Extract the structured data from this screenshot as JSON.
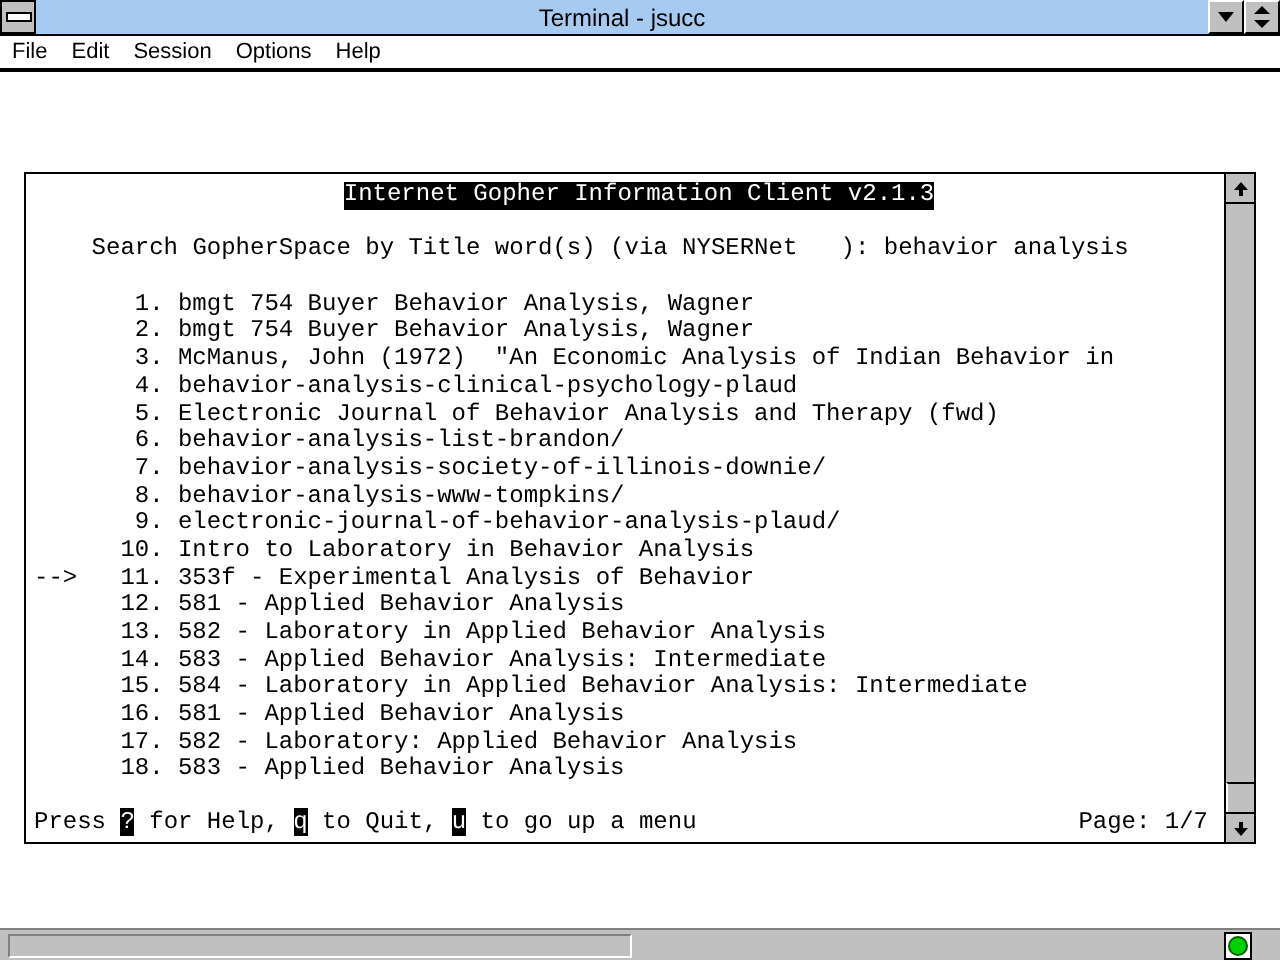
{
  "window": {
    "title": "Terminal - jsucc"
  },
  "menu": [
    "File",
    "Edit",
    "Session",
    "Options",
    "Help"
  ],
  "gopher": {
    "header": "Internet Gopher Information Client v2.1.3",
    "prompt": "Search GopherSpace by Title word(s) (via NYSERNet   ): behavior analysis",
    "items": [
      {
        "number": "1.",
        "title": "bmgt 754 Buyer Behavior Analysis, Wagner"
      },
      {
        "number": "2.",
        "title": "bmgt 754 Buyer Behavior Analysis, Wagner"
      },
      {
        "number": "3.",
        "title": "McManus, John (1972)  \"An Economic Analysis of Indian Behavior in"
      },
      {
        "number": "4.",
        "title": "behavior-analysis-clinical-psychology-plaud"
      },
      {
        "number": "5.",
        "title": "Electronic Journal of Behavior Analysis and Therapy (fwd)"
      },
      {
        "number": "6.",
        "title": "behavior-analysis-list-brandon/"
      },
      {
        "number": "7.",
        "title": "behavior-analysis-society-of-illinois-downie/"
      },
      {
        "number": "8.",
        "title": "behavior-analysis-www-tompkins/"
      },
      {
        "number": "9.",
        "title": "electronic-journal-of-behavior-analysis-plaud/"
      },
      {
        "number": "10.",
        "title": "Intro to Laboratory in Behavior Analysis"
      },
      {
        "pointer": "-->",
        "number": "11.",
        "title": "353f - Experimental Analysis of Behavior"
      },
      {
        "number": "12.",
        "title": "581 - Applied Behavior Analysis"
      },
      {
        "number": "13.",
        "title": "582 - Laboratory in Applied Behavior Analysis"
      },
      {
        "number": "14.",
        "title": "583 - Applied Behavior Analysis: Intermediate"
      },
      {
        "number": "15.",
        "title": "584 - Laboratory in Applied Behavior Analysis: Intermediate"
      },
      {
        "number": "16.",
        "title": "581 - Applied Behavior Analysis"
      },
      {
        "number": "17.",
        "title": "582 - Laboratory: Applied Behavior Analysis"
      },
      {
        "number": "18.",
        "title": "583 - Applied Behavior Analysis"
      }
    ],
    "footer": [
      {
        "text": "Press ",
        "inverse": false
      },
      {
        "text": "?",
        "inverse": true
      },
      {
        "text": " for Help, ",
        "inverse": false
      },
      {
        "text": "q",
        "inverse": true
      },
      {
        "text": " to Quit, ",
        "inverse": false
      },
      {
        "text": "u",
        "inverse": true
      },
      {
        "text": " to go up a menu",
        "inverse": false
      }
    ],
    "page": "Page: 1/7"
  }
}
